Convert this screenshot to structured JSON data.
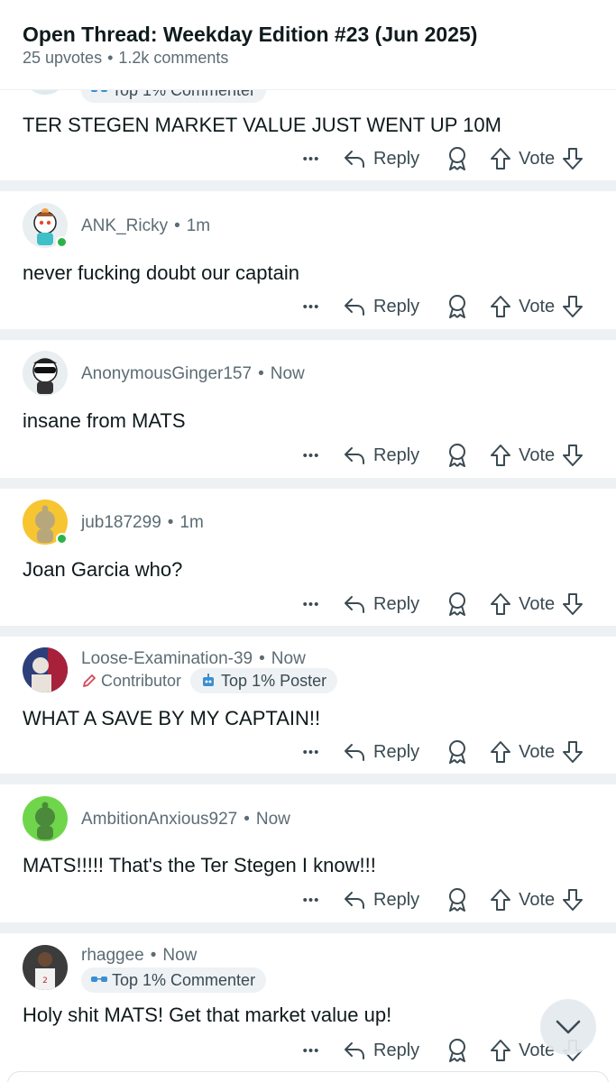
{
  "header": {
    "title": "Open Thread: Weekday Edition #23 (Jun 2025)",
    "upvotes": "25 upvotes",
    "comments": "1.2k comments"
  },
  "actions": {
    "reply": "Reply",
    "vote": "Vote",
    "more": "•••",
    "dot": "•"
  },
  "comments": [
    {
      "flair_partial": "Top 1% Commenter",
      "text": "TER STEGEN MARKET VALUE JUST WENT UP 10M"
    },
    {
      "user": "ANK_Ricky",
      "time": "1m",
      "text": "never fucking doubt our captain",
      "online": true
    },
    {
      "user": "AnonymousGinger157",
      "time": "Now",
      "text": "insane from MATS"
    },
    {
      "user": "jub187299",
      "time": "1m",
      "text": "Joan Garcia who?",
      "online": true
    },
    {
      "user": "Loose-Examination-39",
      "time": "Now",
      "flair_contributor": "Contributor",
      "flair_badge": "Top 1% Poster",
      "text": "WHAT A SAVE BY MY CAPTAIN!!"
    },
    {
      "user": "AmbitionAnxious927",
      "time": "Now",
      "text": "MATS!!!!! That's the Ter Stegen I know!!!"
    },
    {
      "user": "rhaggee",
      "time": "Now",
      "flair_badge": "Top 1% Commenter",
      "text": "Holy shit MATS! Get that market value up!"
    }
  ],
  "colors": {
    "accent_online": "#2bb34a",
    "text_primary": "#0f1a1c",
    "text_secondary": "#5c6c74",
    "separator": "#eef1f3"
  },
  "icons": {
    "reply": "reply-arrow-icon",
    "award": "award-icon",
    "upvote": "upvote-arrow-icon",
    "downvote": "downvote-arrow-icon",
    "more": "more-dots-icon",
    "scroll": "chevron-down-icon"
  }
}
